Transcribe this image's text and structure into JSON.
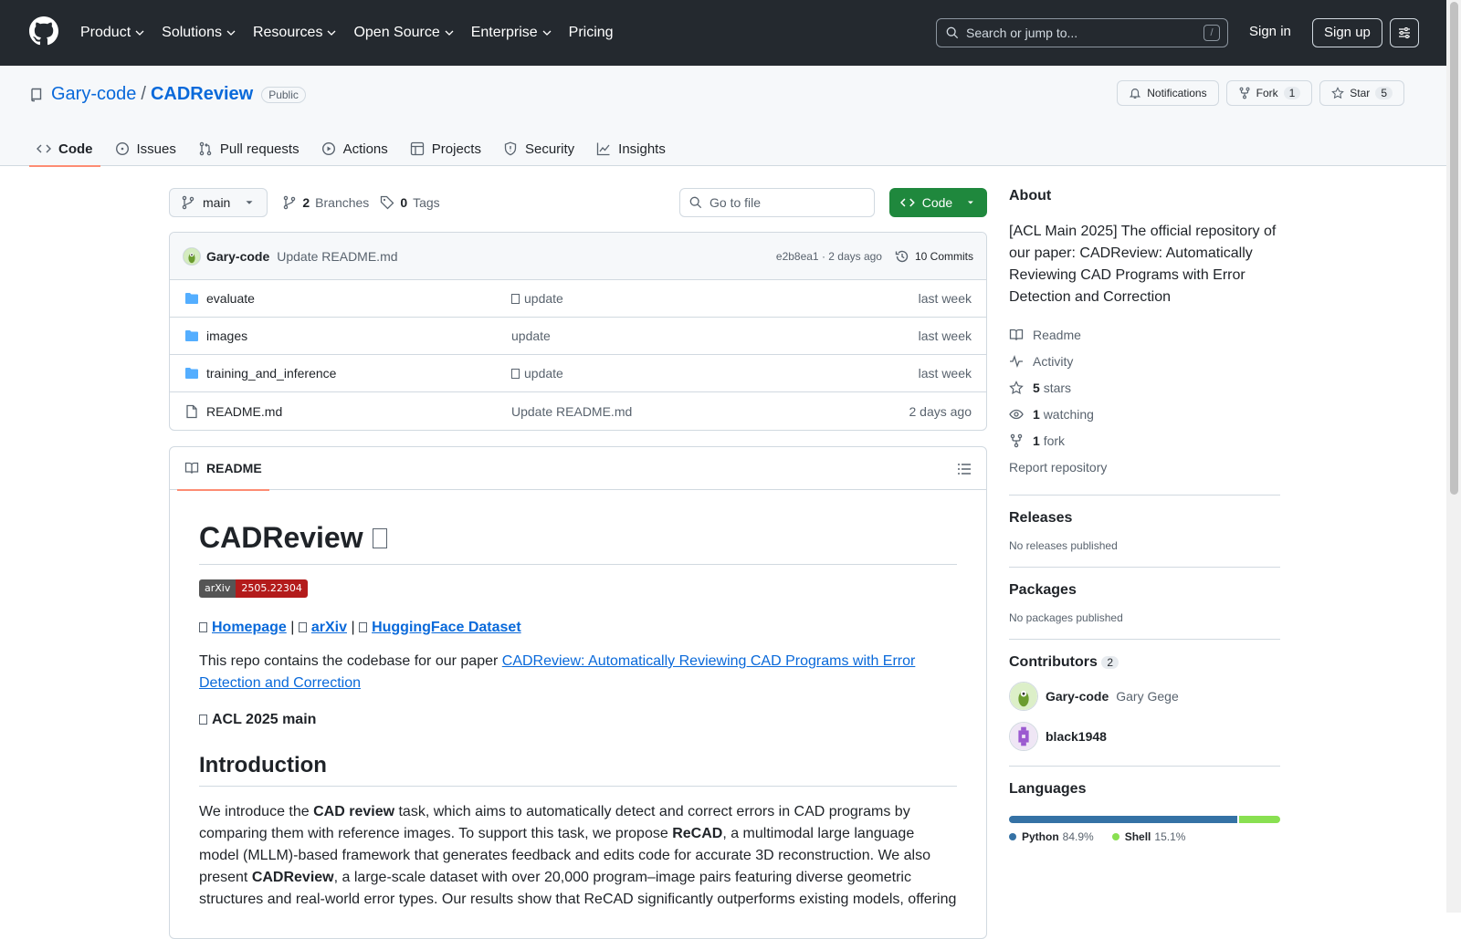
{
  "header": {
    "nav": [
      "Product",
      "Solutions",
      "Resources",
      "Open Source",
      "Enterprise",
      "Pricing"
    ],
    "search_placeholder": "Search or jump to...",
    "search_key": "/",
    "signin": "Sign in",
    "signup": "Sign up"
  },
  "repo": {
    "owner": "Gary-code",
    "separator": "/",
    "name": "CADReview",
    "visibility": "Public",
    "notifications_label": "Notifications",
    "fork_label": "Fork",
    "fork_count": "1",
    "star_label": "Star",
    "star_count": "5",
    "tabs": [
      "Code",
      "Issues",
      "Pull requests",
      "Actions",
      "Projects",
      "Security",
      "Insights"
    ]
  },
  "toolbar": {
    "branch": "main",
    "branches_count": "2",
    "branches_label": "Branches",
    "tags_count": "0",
    "tags_label": "Tags",
    "goto_placeholder": "Go to file",
    "code_button": "Code"
  },
  "commit": {
    "author": "Gary-code",
    "message": "Update README.md",
    "hash_time": "e2b8ea1 · 2 days ago",
    "commits_label": "10 Commits"
  },
  "files": [
    {
      "name": "evaluate",
      "type": "folder",
      "message": "update",
      "message_glyph": true,
      "date": "last week"
    },
    {
      "name": "images",
      "type": "folder",
      "message": "update",
      "message_glyph": false,
      "date": "last week"
    },
    {
      "name": "training_and_inference",
      "type": "folder",
      "message": "update",
      "message_glyph": true,
      "date": "last week"
    },
    {
      "name": "README.md",
      "type": "file",
      "message": "Update README.md",
      "message_glyph": false,
      "date": "2 days ago"
    }
  ],
  "readme": {
    "tab_label": "README",
    "title": "CADReview",
    "badge_left": "arXiv",
    "badge_right": "2505.22304",
    "link_homepage": "Homepage",
    "link_arxiv": "arXiv",
    "link_dataset": "HuggingFace Dataset",
    "link_sep": "|",
    "p1_prefix": "This repo contains the codebase for our paper ",
    "p1_link": "CADReview: Automatically Reviewing CAD Programs with Error Detection and Correction",
    "acl": "ACL 2025 main",
    "intro_heading": "Introduction",
    "intro_1": "We introduce the ",
    "intro_b1": "CAD review",
    "intro_2": " task, which aims to automatically detect and correct errors in CAD programs by comparing them with reference images. To support this task, we propose ",
    "intro_b2": "ReCAD",
    "intro_3": ", a multimodal large language model (MLLM)-based framework that generates feedback and edits code for accurate 3D reconstruction. We also present ",
    "intro_b3": "CADReview",
    "intro_4": ", a large-scale dataset with over 20,000 program–image pairs featuring diverse geometric structures and real-world error types. Our results show that ReCAD significantly outperforms existing models, offering"
  },
  "sidebar": {
    "about_heading": "About",
    "about_text": "[ACL Main 2025] The official repository of our paper: CADReview: Automatically Reviewing CAD Programs with Error Detection and Correction",
    "readme": "Readme",
    "activity": "Activity",
    "stars_count": "5",
    "stars_label": "stars",
    "watching_count": "1",
    "watching_label": "watching",
    "fork_count": "1",
    "fork_label": "fork",
    "report": "Report repository",
    "releases_heading": "Releases",
    "releases_text": "No releases published",
    "packages_heading": "Packages",
    "packages_text": "No packages published",
    "contributors_heading": "Contributors",
    "contributors_count": "2",
    "contributors": [
      {
        "login": "Gary-code",
        "name": "Gary Gege"
      },
      {
        "login": "black1948",
        "name": ""
      }
    ],
    "languages_heading": "Languages",
    "languages": [
      {
        "name": "Python",
        "percent": "84.9%",
        "value": 84.9,
        "color": "#3572A5"
      },
      {
        "name": "Shell",
        "percent": "15.1%",
        "value": 15.1,
        "color": "#89e051"
      }
    ]
  },
  "colors": {
    "header_bg": "#24292f",
    "accent_link": "#0969da",
    "code_button": "#1f883d",
    "tab_underline": "#fd8c73",
    "folder": "#54aeff"
  }
}
